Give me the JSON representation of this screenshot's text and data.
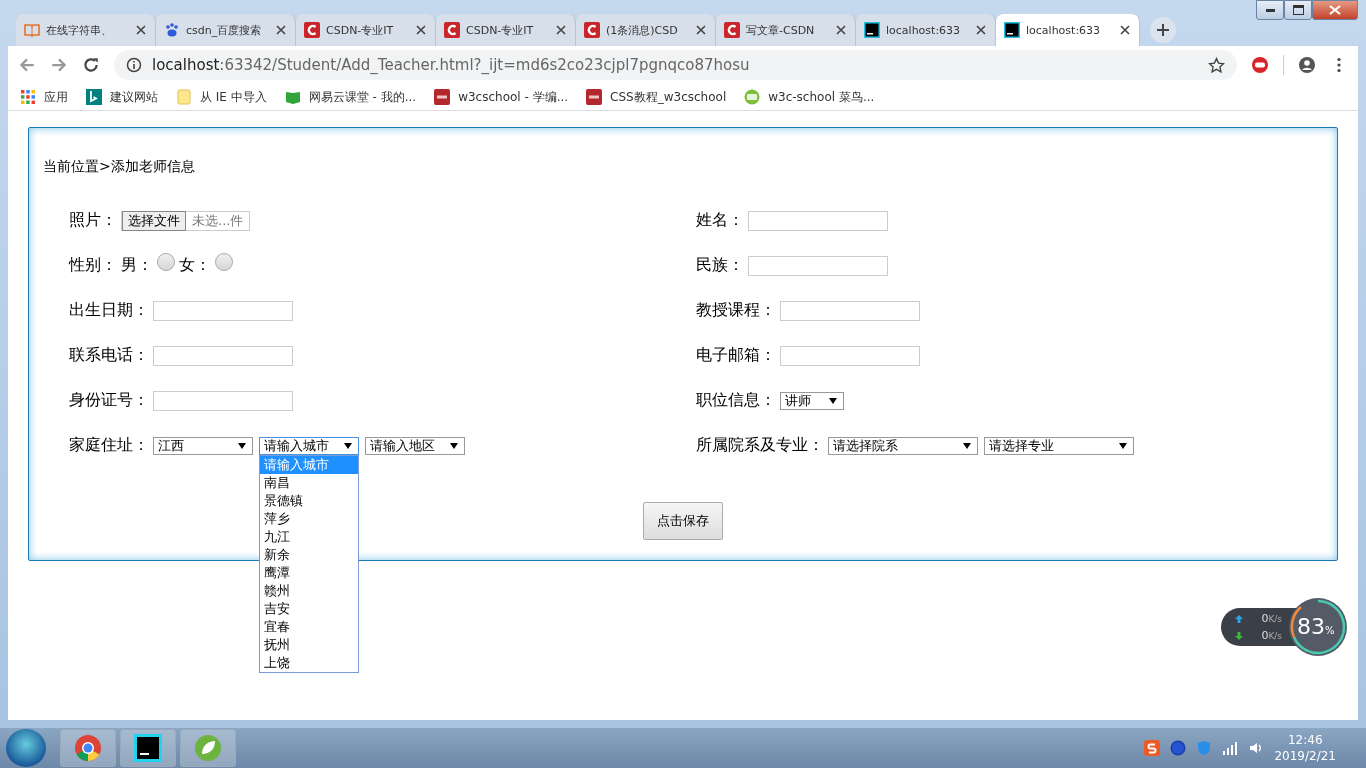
{
  "tabs": [
    {
      "kind": "book",
      "title": "在线字符串、",
      "selected": false
    },
    {
      "kind": "paw",
      "title": "csdn_百度搜索",
      "selected": false
    },
    {
      "kind": "csdn",
      "title": "CSDN-专业IT",
      "selected": false
    },
    {
      "kind": "csdn",
      "title": "CSDN-专业IT",
      "selected": false
    },
    {
      "kind": "csdn",
      "title": "(1条消息)CSD",
      "selected": false
    },
    {
      "kind": "csdn",
      "title": "写文章-CSDN",
      "selected": false
    },
    {
      "kind": "ws",
      "title": "localhost:633",
      "selected": false
    },
    {
      "kind": "ws",
      "title": "localhost:633",
      "selected": true
    }
  ],
  "address": {
    "host": "localhost",
    "rest": ":63342/Student/Add_Teacher.html?_ijt=md6s2co23cjpl7pgnqco87hosu"
  },
  "bookmarks": [
    {
      "kind": "apps",
      "label": "应用"
    },
    {
      "kind": "bing",
      "label": "建议网站"
    },
    {
      "kind": "folder",
      "label": "从 IE 中导入"
    },
    {
      "kind": "greenbook",
      "label": "网易云课堂 - 我的..."
    },
    {
      "kind": "w3c",
      "label": "w3cschool - 学编..."
    },
    {
      "kind": "w3c",
      "label": "CSS教程_w3cschool"
    },
    {
      "kind": "w3cs",
      "label": "w3c-school 菜鸟..."
    }
  ],
  "breadcrumb": "当前位置>添加老师信息",
  "left_fields": [
    {
      "kind": "file",
      "label": "照片：",
      "button": "选择文件",
      "file_text": "未选...件"
    },
    {
      "kind": "radio",
      "label": "性别：",
      "options": [
        {
          "label": "男：",
          "checked": false
        },
        {
          "label": "女：",
          "checked": false
        }
      ]
    },
    {
      "kind": "text",
      "label": "出生日期："
    },
    {
      "kind": "text",
      "label": "联系电话："
    },
    {
      "kind": "text",
      "label": "身份证号："
    },
    {
      "kind": "select",
      "label": "家庭住址：",
      "selects": [
        {
          "value": "江西",
          "open": false
        },
        {
          "value": "请输入城市",
          "open": true
        },
        {
          "value": "请输入地区",
          "open": false
        }
      ]
    }
  ],
  "right_fields": [
    {
      "kind": "text",
      "label": "姓名："
    },
    {
      "kind": "text",
      "label": "民族："
    },
    {
      "kind": "text",
      "label": "教授课程："
    },
    {
      "kind": "text",
      "label": "电子邮箱："
    },
    {
      "kind": "select",
      "label": "职位信息：",
      "selects": [
        {
          "value": "讲师",
          "open": false
        }
      ]
    },
    {
      "kind": "select",
      "label": "所属院系及专业：",
      "selects": [
        {
          "value": "请选择院系",
          "open": false
        },
        {
          "value": "请选择专业",
          "open": false
        }
      ]
    }
  ],
  "city_options": [
    {
      "label": "请输入城市",
      "selected": true
    },
    {
      "label": "南昌",
      "selected": false
    },
    {
      "label": "景德镇",
      "selected": false
    },
    {
      "label": "萍乡",
      "selected": false
    },
    {
      "label": "九江",
      "selected": false
    },
    {
      "label": "新余",
      "selected": false
    },
    {
      "label": "鹰潭",
      "selected": false
    },
    {
      "label": "赣州",
      "selected": false
    },
    {
      "label": "吉安",
      "selected": false
    },
    {
      "label": "宜春",
      "selected": false
    },
    {
      "label": "抚州",
      "selected": false
    },
    {
      "label": "上饶",
      "selected": false
    }
  ],
  "save_button": "点击保存",
  "net_widget": {
    "up_value": "0",
    "up_unit": "K/s",
    "down_value": "0",
    "down_unit": "K/s",
    "percent": "83",
    "percent_sign": "%"
  },
  "taskbar": {
    "apps": [
      {
        "kind": "chrome"
      },
      {
        "kind": "ws"
      },
      {
        "kind": "spring"
      }
    ],
    "time": "12:46",
    "date": "2019/2/21"
  }
}
